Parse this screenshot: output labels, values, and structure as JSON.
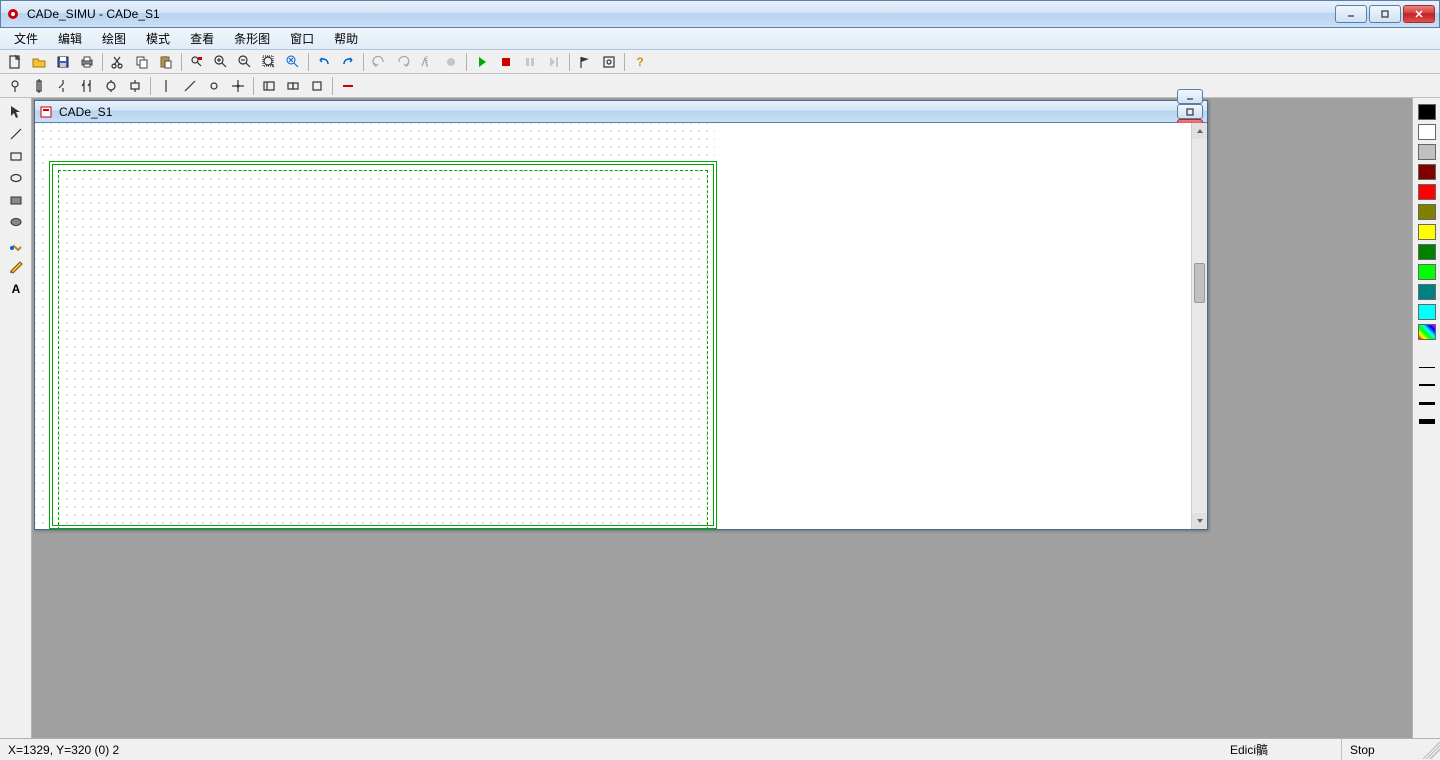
{
  "window": {
    "title": "CADe_SIMU - CADe_S1"
  },
  "menu": {
    "items": [
      "文件",
      "编辑",
      "绘图",
      "模式",
      "查看",
      "条形图",
      "窗口",
      "帮助"
    ]
  },
  "toolbar1": {
    "buttons": [
      {
        "name": "new-icon"
      },
      {
        "name": "open-icon"
      },
      {
        "name": "save-icon"
      },
      {
        "name": "print-icon"
      },
      {
        "sep": true
      },
      {
        "name": "cut-icon"
      },
      {
        "name": "copy-icon"
      },
      {
        "name": "paste-icon"
      },
      {
        "sep": true
      },
      {
        "name": "find-icon"
      },
      {
        "name": "zoom-in-icon"
      },
      {
        "name": "zoom-out-icon"
      },
      {
        "name": "zoom-fit-icon"
      },
      {
        "name": "zoom-region-icon"
      },
      {
        "sep": true
      },
      {
        "name": "undo-icon"
      },
      {
        "name": "redo-icon"
      },
      {
        "sep": true
      },
      {
        "name": "rotate-left-icon",
        "disabled": true
      },
      {
        "name": "rotate-right-icon",
        "disabled": true
      },
      {
        "name": "mirror-icon",
        "disabled": true
      },
      {
        "name": "record-icon",
        "disabled": true
      },
      {
        "sep": true
      },
      {
        "name": "play-icon",
        "color": "#0a0"
      },
      {
        "name": "stop-icon",
        "color": "#c00"
      },
      {
        "name": "pause-icon",
        "disabled": true
      },
      {
        "name": "step-icon",
        "disabled": true
      },
      {
        "sep": true
      },
      {
        "name": "flag-icon"
      },
      {
        "name": "settings-icon"
      },
      {
        "sep": true
      },
      {
        "name": "help-icon",
        "color": "#cc9900"
      }
    ]
  },
  "toolbar2": {
    "buttons": [
      {
        "name": "lamp-icon"
      },
      {
        "name": "fuse-icon"
      },
      {
        "name": "contact-no-icon"
      },
      {
        "name": "contact-nc-icon"
      },
      {
        "name": "coil-icon"
      },
      {
        "name": "motor-icon"
      },
      {
        "sep": true
      },
      {
        "name": "wire-icon"
      },
      {
        "name": "wire-diag-icon"
      },
      {
        "name": "node-icon"
      },
      {
        "name": "junction-icon"
      },
      {
        "sep": true
      },
      {
        "name": "block1-icon"
      },
      {
        "name": "block2-icon"
      },
      {
        "name": "block3-icon"
      },
      {
        "sep": true
      },
      {
        "name": "line-red-icon",
        "color": "#c00"
      }
    ]
  },
  "leftTools": {
    "items": [
      {
        "name": "select-tool-icon"
      },
      {
        "name": "line-tool-icon"
      },
      {
        "name": "rect-tool-icon"
      },
      {
        "name": "ellipse-tool-icon"
      },
      {
        "name": "filled-rect-tool-icon"
      },
      {
        "name": "filled-ellipse-tool-icon"
      },
      {
        "name": "brush-tool-icon"
      },
      {
        "name": "pencil-tool-icon"
      },
      {
        "name": "text-tool-icon"
      }
    ]
  },
  "childWindow": {
    "title": "CADe_S1"
  },
  "palette": {
    "colors": [
      "#000000",
      "#ffffff",
      "#c0c0c0",
      "#800000",
      "#ff0000",
      "#808000",
      "#ffff00",
      "#008000",
      "#00ff00",
      "#008080",
      "#00ffff"
    ],
    "rainbow": true,
    "lineWeights": [
      1,
      2,
      3,
      5
    ]
  },
  "status": {
    "coords": "X=1329, Y=320 (0) 2",
    "mode": "Edici髇",
    "sim": "Stop"
  }
}
